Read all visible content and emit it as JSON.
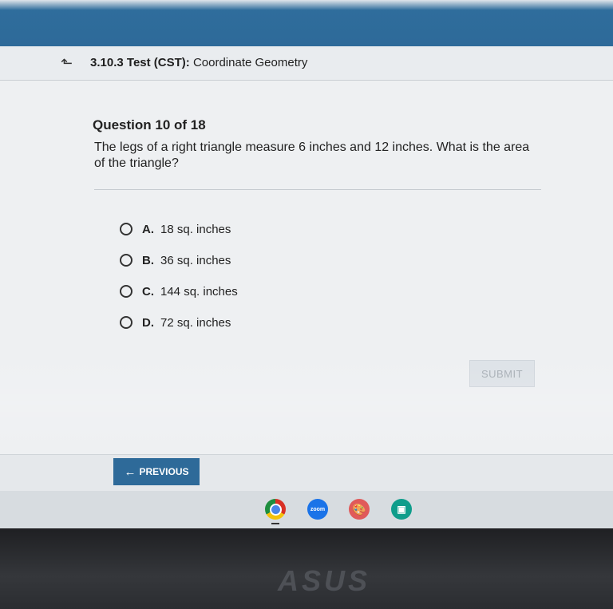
{
  "header": {
    "test_code": "3.10.3",
    "test_name": "Test (CST):",
    "subject": "Coordinate Geometry"
  },
  "question": {
    "number_label": "Question 10 of 18",
    "text": "The legs of a right triangle measure 6 inches and 12 inches. What is the area of the triangle?",
    "options": [
      {
        "letter": "A.",
        "text": "18 sq. inches",
        "selected": false
      },
      {
        "letter": "B.",
        "text": "36 sq. inches",
        "selected": false
      },
      {
        "letter": "C.",
        "text": "144 sq. inches",
        "selected": false
      },
      {
        "letter": "D.",
        "text": "72 sq. inches",
        "selected": false
      }
    ]
  },
  "actions": {
    "submit_label": "SUBMIT",
    "previous_label": "PREVIOUS"
  },
  "shelf": {
    "apps": [
      {
        "name": "chrome-icon"
      },
      {
        "name": "zoom-icon",
        "label": "zoom"
      },
      {
        "name": "palette-icon"
      },
      {
        "name": "camera-icon"
      }
    ]
  },
  "device": {
    "brand": "ASUS"
  },
  "colors": {
    "accent": "#2e6a99",
    "page_background": "#eef0f2",
    "submit_disabled_text": "#a7aeb5"
  }
}
